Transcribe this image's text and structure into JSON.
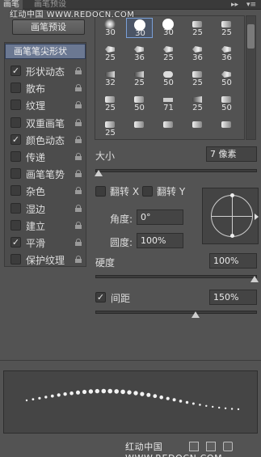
{
  "tabs": [
    {
      "label": "画笔",
      "active": true
    },
    {
      "label": "画笔预设",
      "active": false
    }
  ],
  "watermark_top": "红动中国 WWW.REDOCN.COM",
  "panel_controls": {
    "collapse": "▸▸",
    "menu": "▾≡"
  },
  "preset_button": "画笔预设",
  "left_list": {
    "header": "画笔笔尖形状",
    "items": [
      {
        "label": "形状动态",
        "checked": true,
        "check": "✓"
      },
      {
        "label": "散布",
        "checked": false,
        "check": ""
      },
      {
        "label": "纹理",
        "checked": false,
        "check": ""
      },
      {
        "label": "双重画笔",
        "checked": false,
        "check": ""
      },
      {
        "label": "颜色动态",
        "checked": true,
        "check": "✓"
      },
      {
        "label": "传递",
        "checked": false,
        "check": ""
      },
      {
        "label": "画笔笔势",
        "checked": false,
        "check": ""
      },
      {
        "label": "杂色",
        "checked": false,
        "check": ""
      },
      {
        "label": "湿边",
        "checked": false,
        "check": ""
      },
      {
        "label": "建立",
        "checked": false,
        "check": ""
      },
      {
        "label": "平滑",
        "checked": true,
        "check": "✓"
      },
      {
        "label": "保护纹理",
        "checked": false,
        "check": ""
      }
    ]
  },
  "brush_grid": {
    "selected_index": 1,
    "cells": [
      {
        "num": "30",
        "icon": "soft-round-brush-icon"
      },
      {
        "num": "30",
        "icon": "hard-round-brush-icon"
      },
      {
        "num": "30",
        "icon": "hard-round-brush-icon"
      },
      {
        "num": "25",
        "icon": "bar-brush-icon"
      },
      {
        "num": "25",
        "icon": "bar-brush-icon"
      },
      {
        "num": "25",
        "icon": "bristle-brush-icon"
      },
      {
        "num": "36",
        "icon": "bristle-brush-icon"
      },
      {
        "num": "25",
        "icon": "bristle-brush-icon"
      },
      {
        "num": "36",
        "icon": "bristle-brush-icon"
      },
      {
        "num": "36",
        "icon": "bristle-brush-icon"
      },
      {
        "num": "32",
        "icon": "dark-brush-icon"
      },
      {
        "num": "25",
        "icon": "dark-brush-icon"
      },
      {
        "num": "50",
        "icon": "round-brush-icon"
      },
      {
        "num": "25",
        "icon": "bar-brush-icon"
      },
      {
        "num": "50",
        "icon": "bristle-brush-icon"
      },
      {
        "num": "25",
        "icon": "bar-brush-icon"
      },
      {
        "num": "50",
        "icon": "bar-brush-icon"
      },
      {
        "num": "71",
        "icon": "flat-brush-icon"
      },
      {
        "num": "25",
        "icon": "dark-brush-icon"
      },
      {
        "num": "50",
        "icon": "bar-brush-icon"
      },
      {
        "num": "25",
        "icon": "bar-brush-icon"
      },
      {
        "num": "",
        "icon": "bar-brush-icon"
      },
      {
        "num": "",
        "icon": "bar-brush-icon"
      },
      {
        "num": "",
        "icon": "bar-brush-icon"
      },
      {
        "num": "",
        "icon": "bar-brush-icon"
      }
    ]
  },
  "size": {
    "label": "大小",
    "value": "7 像素",
    "slider_fraction": 0.02
  },
  "flip": {
    "x_label": "翻转 X",
    "y_label": "翻转 Y",
    "x_checked": false,
    "y_checked": false
  },
  "angle": {
    "label": "角度:",
    "value": "0°"
  },
  "roundness": {
    "label": "圆度:",
    "value": "100%"
  },
  "hardness": {
    "label": "硬度",
    "value": "100%",
    "slider_fraction": 1.0
  },
  "spacing": {
    "label": "间距",
    "checked": true,
    "check": "✓",
    "value": "150%",
    "slider_fraction": 0.5
  },
  "watermark_bottom": "红动中国 WWW.REDOCN.COM"
}
